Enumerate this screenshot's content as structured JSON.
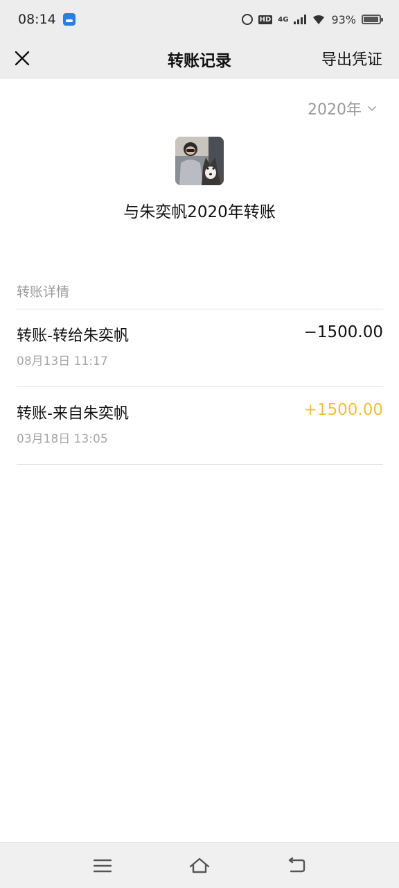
{
  "status": {
    "time": "08:14",
    "network": "4G",
    "battery": "93%"
  },
  "nav": {
    "title": "转账记录",
    "export_label": "导出凭证"
  },
  "filter": {
    "year": "2020年"
  },
  "header": {
    "title": "与朱奕帆2020年转账"
  },
  "section": {
    "label": "转账详情"
  },
  "records": [
    {
      "title": "转账-转给朱奕帆",
      "date": "08月13日 11:17",
      "amount": "−1500.00",
      "direction": "out"
    },
    {
      "title": "转账-来自朱奕帆",
      "date": "03月18日 13:05",
      "amount": "+1500.00",
      "direction": "in"
    }
  ],
  "colors": {
    "incoming": "#efbf3a",
    "bar_bg": "#ededed"
  },
  "icons": {
    "close": "close-icon",
    "chevron": "chevron-down-icon",
    "menu": "menu-icon",
    "home": "home-icon",
    "back": "back-icon"
  }
}
